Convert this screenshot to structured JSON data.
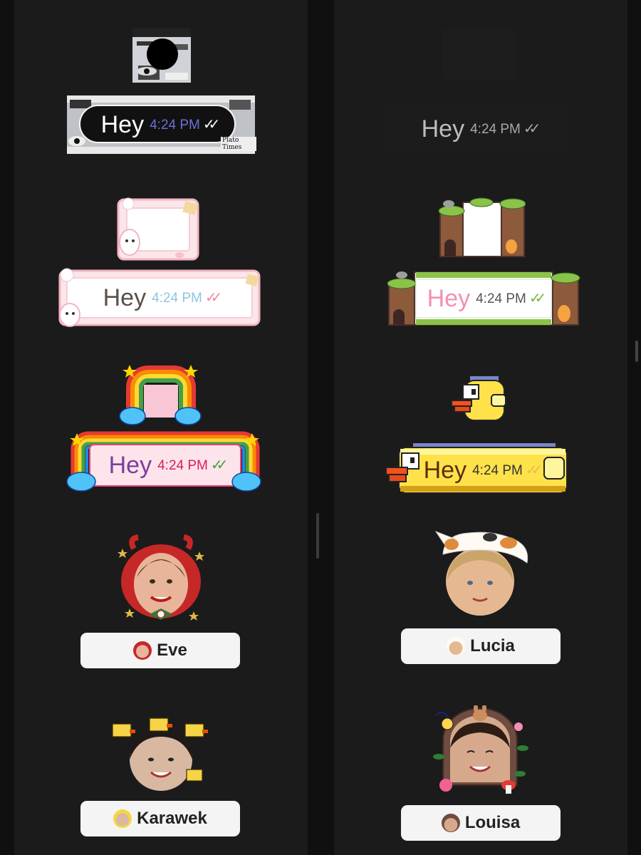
{
  "message": {
    "text": "Hey",
    "time": "4:24 PM",
    "status_ticks": "✓✓"
  },
  "profiles": [
    {
      "name": "Eve"
    },
    {
      "name": "Lucia"
    },
    {
      "name": "Karawek"
    },
    {
      "name": "Louisa"
    }
  ],
  "frame_stamp": {
    "text": "Plato Times"
  },
  "colors": {
    "background": "#101010",
    "column": "#1b1b1b",
    "pill": "#f4f4f4",
    "pink_bubble": "#fdeef0",
    "rainbow_bubble": "#fce4ea",
    "forest_bubble": "#ffffff",
    "bird_bubble": "#ffe24a"
  },
  "icons": [
    "double-check-icon",
    "avatar-icon",
    "bunny-icon",
    "cat-icon",
    "star-icon",
    "cloud-icon",
    "pixel-bird-icon"
  ]
}
